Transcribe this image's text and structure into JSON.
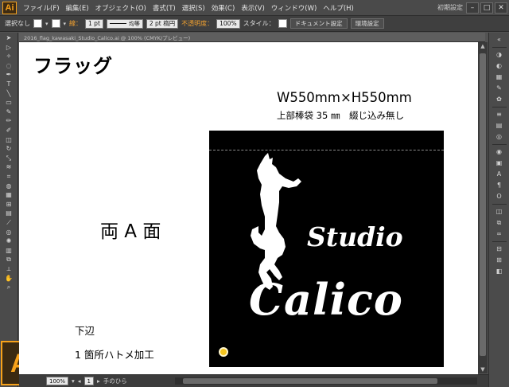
{
  "app": {
    "logo": "Ai",
    "menu": [
      "ファイル(F)",
      "編集(E)",
      "オブジェクト(O)",
      "書式(T)",
      "選択(S)",
      "効果(C)",
      "表示(V)",
      "ウィンドウ(W)",
      "ヘルプ(H)"
    ],
    "workspace": "初期設定",
    "window_buttons": [
      "–",
      "□",
      "✕"
    ]
  },
  "control_bar": {
    "selection": "選択なし",
    "stroke_label": "線：",
    "stroke_weight": "1 pt",
    "stroke_style": "均等",
    "brush": "2 pt 楕円",
    "opacity_label": "不透明度：",
    "opacity_value": "100%",
    "style_label": "スタイル：",
    "doc_setup_button": "ドキュメント設定",
    "preferences_button": "環境設定"
  },
  "document_tab": {
    "title": "2016_flag_kawasaki_Studio_Calico.ai @ 100% (CMYK/プレビュー)"
  },
  "artboard": {
    "title": "フラッグ",
    "size": "W550mm×H550mm",
    "spec": "上部棒袋 35 ㎜　綴じ込み無し",
    "sides": "両 A 面",
    "bottom_edge": "下辺",
    "grommet_note": "1 箇所ハトメ加工",
    "flag": {
      "line1": "Studio",
      "line2": "Calico",
      "background": "#000000",
      "text_color": "#ffffff",
      "grommet_color": "#f5c51e"
    }
  },
  "status_bar": {
    "zoom": "100%",
    "page": "1",
    "tool": "手のひら"
  },
  "colors": {
    "accent": "#f7a21b",
    "ui_dark": "#4b4b4b"
  }
}
